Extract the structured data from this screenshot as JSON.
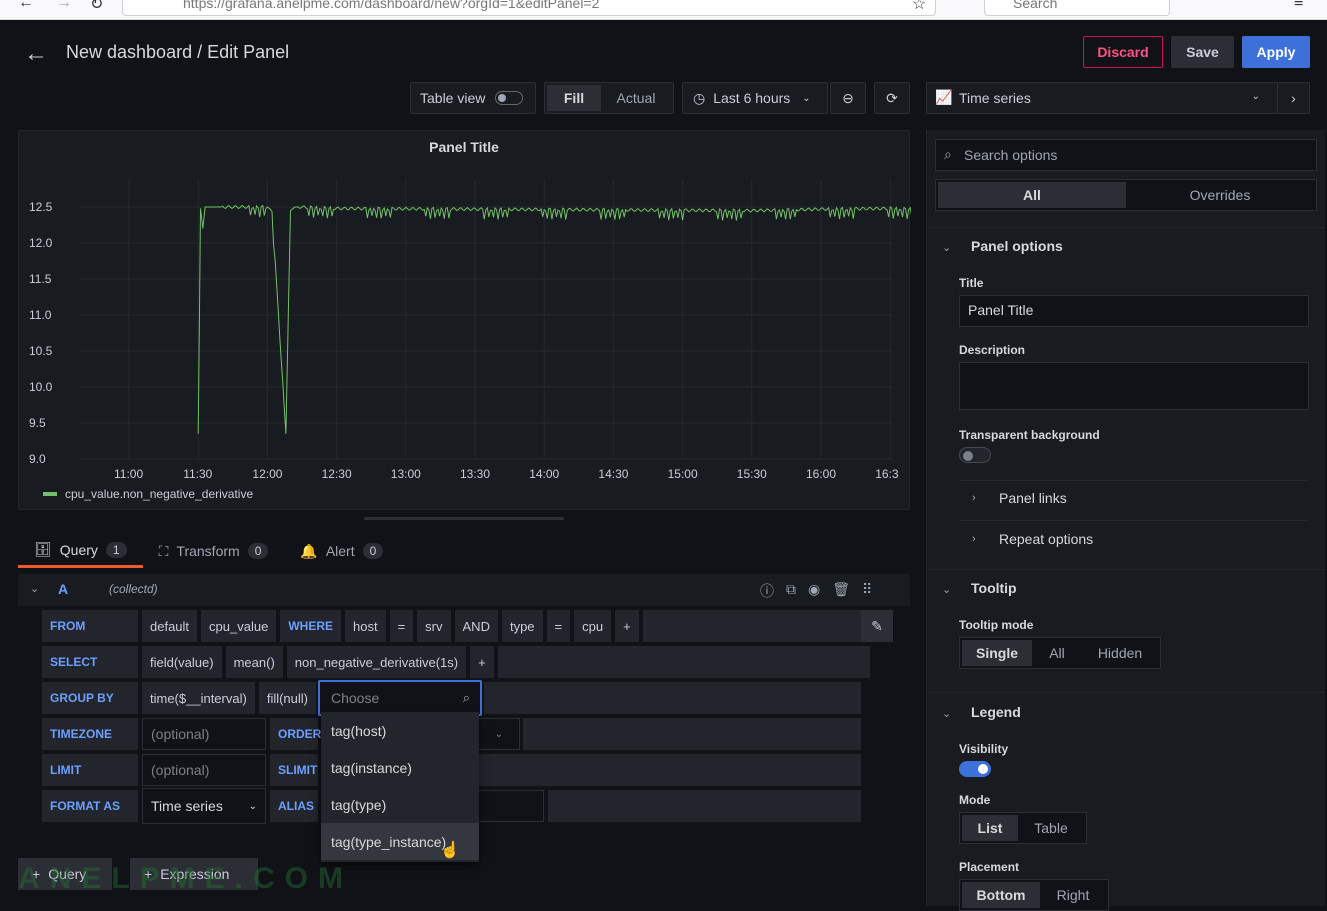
{
  "browser": {
    "url": "https://grafana.anelpme.com/dashboard/new?orgId=1&editPanel=2",
    "search_placeholder": "Search"
  },
  "header": {
    "title": "New dashboard / Edit Panel",
    "discard_label": "Discard",
    "save_label": "Save",
    "apply_label": "Apply"
  },
  "toolbar": {
    "table_view_label": "Table view",
    "fill_label": "Fill",
    "actual_label": "Actual",
    "time_range_label": "Last 6 hours"
  },
  "panel": {
    "title": "Panel Title",
    "legend": "cpu_value.non_negative_derivative"
  },
  "chart_data": {
    "type": "line",
    "title": "Panel Title",
    "y_ticks": [
      "12.5",
      "12.0",
      "11.5",
      "11.0",
      "10.5",
      "10.0",
      "9.5",
      "9.0"
    ],
    "x_ticks": [
      "11:00",
      "11:30",
      "12:00",
      "12:30",
      "13:00",
      "13:30",
      "14:00",
      "14:30",
      "15:00",
      "15:30",
      "16:00",
      "16:3"
    ],
    "ylim": [
      9.0,
      12.5
    ],
    "series": [
      {
        "name": "cpu_value.non_negative_derivative",
        "color": "#73bf69",
        "x_minutes_since_1030": [
          60,
          61,
          62,
          63,
          70,
          90,
          92,
          98,
          100,
          102,
          104,
          120,
          180,
          240,
          300,
          330,
          360,
          390,
          400,
          420,
          457
        ],
        "values": [
          9.35,
          12.48,
          12.2,
          12.5,
          12.5,
          12.5,
          12.45,
          9.35,
          12.45,
          12.5,
          12.5,
          12.48,
          12.47,
          12.46,
          12.45,
          12.47,
          12.48,
          12.46,
          12.5,
          12.48,
          12.48
        ]
      }
    ]
  },
  "query_tabs": [
    {
      "label": "Query",
      "count": "1"
    },
    {
      "label": "Transform",
      "count": "0"
    },
    {
      "label": "Alert",
      "count": "0"
    }
  ],
  "query": {
    "ref": "A",
    "datasource": "(collectd)",
    "from_kw": "FROM",
    "from": [
      "default",
      "cpu_value",
      "WHERE",
      "host",
      "=",
      "srv",
      "AND",
      "type",
      "=",
      "cpu",
      "+"
    ],
    "select_kw": "SELECT",
    "select": [
      "field(value)",
      "mean()",
      "non_negative_derivative(1s)",
      "+"
    ],
    "groupby_kw": "GROUP BY",
    "groupby": [
      "time($__interval)",
      "fill(null)"
    ],
    "choose_placeholder": "Choose",
    "timezone_kw": "TIMEZONE",
    "optional_placeholder": "(optional)",
    "order_kw": "ORDER",
    "limit_kw": "LIMIT",
    "slimit_kw": "SLIMIT",
    "format_kw": "FORMAT AS",
    "format_value": "Time series",
    "alias_kw": "ALIAS",
    "dropdown": [
      "tag(host)",
      "tag(instance)",
      "tag(type)",
      "tag(type_instance)"
    ],
    "add_query_label": "Query",
    "add_expression_label": "Expression"
  },
  "watermark": "ANELPME.COM",
  "options": {
    "viz_label": "Time series",
    "search_placeholder": "Search options",
    "tab_all": "All",
    "tab_overrides": "Overrides",
    "panel_options_title": "Panel options",
    "title_label": "Title",
    "title_value": "Panel Title",
    "description_label": "Description",
    "transparent_label": "Transparent background",
    "panel_links": "Panel links",
    "repeat_options": "Repeat options",
    "tooltip_title": "Tooltip",
    "tooltip_mode_label": "Tooltip mode",
    "tooltip_modes": [
      "Single",
      "All",
      "Hidden"
    ],
    "legend_title": "Legend",
    "visibility_label": "Visibility",
    "mode_label": "Mode",
    "modes": [
      "List",
      "Table"
    ],
    "placement_label": "Placement",
    "placements": [
      "Bottom",
      "Right"
    ]
  }
}
